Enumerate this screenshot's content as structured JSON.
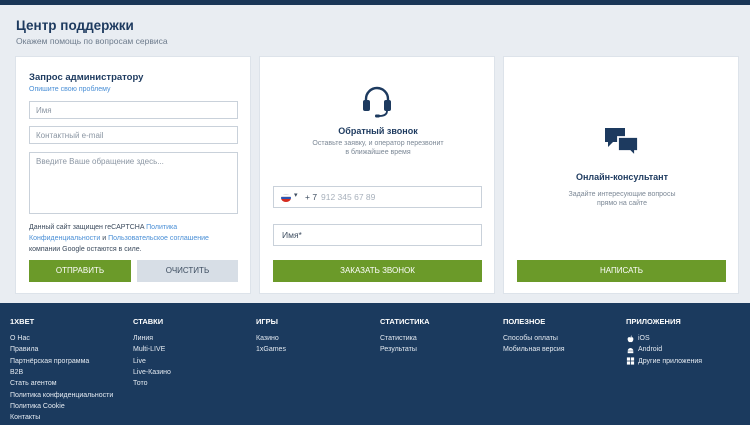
{
  "header": {
    "title": "Центр поддержки",
    "subtitle": "Окажем помощь по вопросам сервиса"
  },
  "admin_card": {
    "title": "Запрос администратору",
    "subtitle": "Опишите свою проблему",
    "name_placeholder": "Имя",
    "email_placeholder": "Контактный e-mail",
    "message_placeholder": "Введите Ваше обращение здесь...",
    "recaptcha": {
      "part1": "Данный сайт защищен reCAPTCHA ",
      "privacy_link": "Политика Конфиденциальности",
      "part2": " и ",
      "terms_link": "Пользовательское соглашение",
      "part3": " компании Google остаются в силе."
    },
    "send_label": "Отправить",
    "clear_label": "Очистить"
  },
  "callback_card": {
    "icon": "headset-icon",
    "title": "Обратный звонок",
    "subtitle": "Оставьте заявку, и оператор перезвонит в ближайшее время",
    "country_code": "+ 7",
    "phone_placeholder": "912 345 67 89",
    "name_placeholder": "Имя*",
    "button_label": "Заказать звонок"
  },
  "chat_card": {
    "icon": "chat-bubbles-icon",
    "title": "Онлайн-консультант",
    "subtitle": "Задайте интересующие вопросы прямо на сайте",
    "button_label": "Написать"
  },
  "colors": {
    "navy": "#1b3a5e",
    "green": "#6b9a29",
    "link": "#4a8fd6"
  },
  "footer": {
    "columns": [
      {
        "heading": "1XBET",
        "items": [
          "О Нас",
          "Правила",
          "Партнёрская программа",
          "B2B",
          "Стать агентом",
          "Политика конфиденциальности",
          "Политика Cookie",
          "Контакты"
        ]
      },
      {
        "heading": "Ставки",
        "items": [
          "Линия",
          "Multi-LIVE",
          "Live",
          "Live-Казино",
          "Тото"
        ]
      },
      {
        "heading": "Игры",
        "items": [
          "Казино",
          "1xGames"
        ]
      },
      {
        "heading": "Статистика",
        "items": [
          "Статистика",
          "Результаты"
        ]
      },
      {
        "heading": "Полезное",
        "items": [
          "Способы оплаты",
          "Мобильная версия"
        ]
      },
      {
        "heading": "Приложения",
        "items": [
          "iOS",
          "Android",
          "Другие приложения"
        ]
      }
    ],
    "app_icons": [
      "apple-icon",
      "android-icon",
      "grid-apps-icon"
    ]
  }
}
